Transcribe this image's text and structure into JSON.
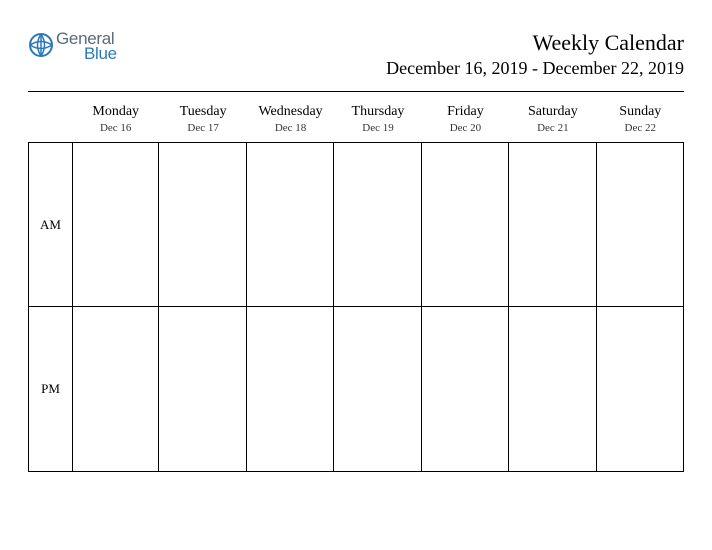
{
  "logo": {
    "text_general": "General",
    "text_blue": "Blue"
  },
  "title": "Weekly Calendar",
  "date_range": "December 16, 2019 - December 22, 2019",
  "row_labels": {
    "am": "AM",
    "pm": "PM"
  },
  "days": [
    {
      "name": "Monday",
      "date": "Dec 16"
    },
    {
      "name": "Tuesday",
      "date": "Dec 17"
    },
    {
      "name": "Wednesday",
      "date": "Dec 18"
    },
    {
      "name": "Thursday",
      "date": "Dec 19"
    },
    {
      "name": "Friday",
      "date": "Dec 20"
    },
    {
      "name": "Saturday",
      "date": "Dec 21"
    },
    {
      "name": "Sunday",
      "date": "Dec 22"
    }
  ]
}
